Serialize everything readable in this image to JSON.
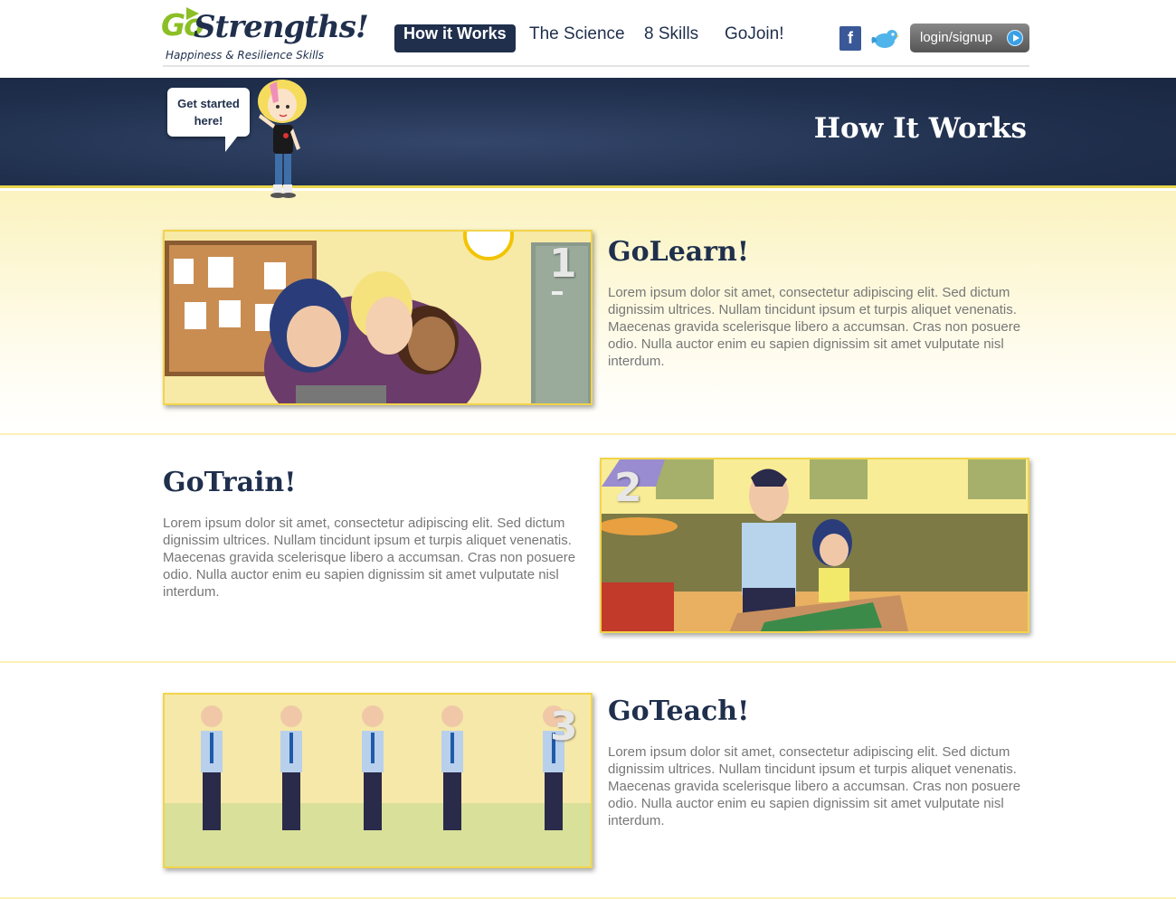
{
  "header": {
    "logo_go": "Go",
    "logo_name": "Strengths!",
    "logo_tagline": "Happiness & Resilience Skills",
    "nav": [
      {
        "label": "How it Works",
        "active": true
      },
      {
        "label": "The Science",
        "active": false
      },
      {
        "label": "8 Skills",
        "active": false
      },
      {
        "label": "GoJoin!",
        "active": false
      }
    ],
    "social": {
      "facebook": "f",
      "facebook_icon": "facebook-icon",
      "twitter_icon": "twitter-icon"
    },
    "login_label": "login/signup"
  },
  "banner": {
    "title": "How It Works",
    "bubble_line1": "Get started",
    "bubble_line2": "here!"
  },
  "steps": [
    {
      "number": "1",
      "title": "GoLearn!",
      "text": "Lorem ipsum dolor sit amet, consectetur adipiscing elit. Sed dictum dignissim ultrices. Nullam tincidunt ipsum et turpis aliquet venenatis. Maecenas gravida scelerisque libero a accumsan. Cras non posuere odio. Nulla auctor enim eu sapien dignissim sit amet vulputate nisl interdum."
    },
    {
      "number": "2",
      "title": "GoTrain!",
      "text": "Lorem ipsum dolor sit amet, consectetur adipiscing elit. Sed dictum dignissim ultrices. Nullam tincidunt ipsum et turpis aliquet venenatis. Maecenas gravida scelerisque libero a accumsan. Cras non posuere odio. Nulla auctor enim eu sapien dignissim sit amet vulputate nisl interdum."
    },
    {
      "number": "3",
      "title": "GoTeach!",
      "text": "Lorem ipsum dolor sit amet, consectetur adipiscing elit. Sed dictum dignissim ultrices. Nullam tincidunt ipsum et turpis aliquet venenatis. Maecenas gravida scelerisque libero a accumsan. Cras non posuere odio. Nulla auctor enim eu sapien dignissim sit amet vulputate nisl interdum."
    }
  ],
  "colors": {
    "navy": "#1f2f4c",
    "green": "#8cbf26",
    "yellow": "#f2d44a",
    "cream": "#fbf3c0"
  }
}
